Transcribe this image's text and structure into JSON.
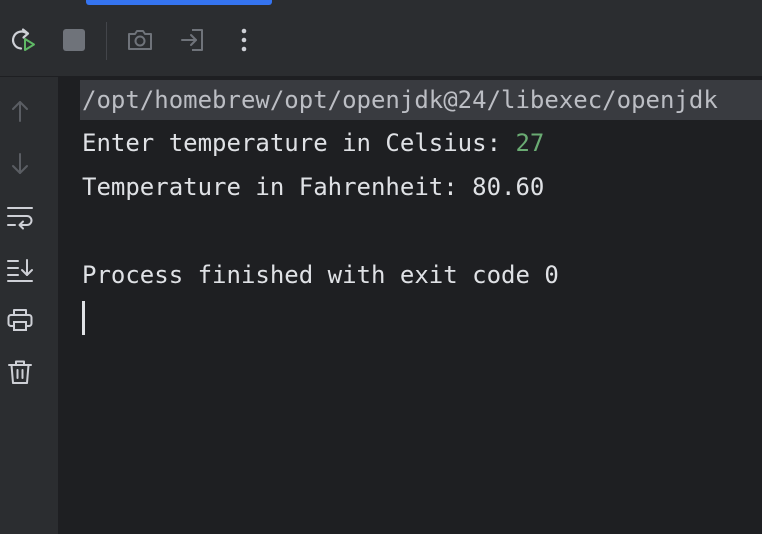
{
  "toolbar": {
    "items": [
      {
        "name": "rerun-icon"
      },
      {
        "name": "stop-icon"
      },
      {
        "name": "camera-icon"
      },
      {
        "name": "login-icon"
      },
      {
        "name": "more-vertical-icon"
      }
    ],
    "colors": {
      "rerun_play": "#5fb865",
      "icon": "#ced0d6",
      "disabled": "#6f737a"
    }
  },
  "gutter": {
    "items": [
      {
        "name": "arrow-up-icon"
      },
      {
        "name": "arrow-down-icon"
      },
      {
        "name": "soft-wrap-icon"
      },
      {
        "name": "scroll-to-end-icon"
      },
      {
        "name": "print-icon"
      },
      {
        "name": "trash-icon"
      }
    ]
  },
  "console": {
    "command": "/opt/homebrew/opt/openjdk@24/libexec/openjdk",
    "prompt": "Enter temperature in Celsius: ",
    "input_value": "27",
    "result": "Temperature in Fahrenheit: 80.60",
    "exit_message": "Process finished with exit code 0",
    "colors": {
      "text": "#dfe1e5",
      "input": "#6aab73",
      "command_bg": "#393b40"
    }
  }
}
